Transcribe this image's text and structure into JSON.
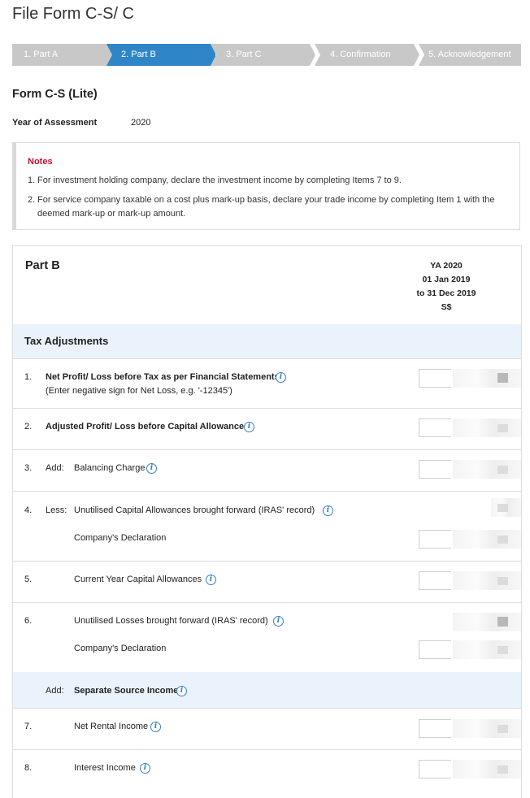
{
  "page_title": "File Form C-S/ C",
  "steps": [
    {
      "label": "1. Part A",
      "state": "inactive"
    },
    {
      "label": "2. Part B",
      "state": "active"
    },
    {
      "label": "3. Part C",
      "state": "inactive"
    },
    {
      "label": "4. Confirmation",
      "state": "inactive"
    },
    {
      "label": "5. Acknowledgement",
      "state": "inactive"
    }
  ],
  "colors": {
    "active_step": "#2e86c9",
    "inactive_step": "#c8c8c8",
    "notes_title": "#c8102e",
    "band": "#eaf3fb",
    "info_icon": "#3a7fc4"
  },
  "form_title": "Form C-S (Lite)",
  "year_of_assessment": {
    "label": "Year of Assessment",
    "value": "2020"
  },
  "notes": {
    "title": "Notes",
    "items": [
      {
        "num": "1.",
        "text": "For investment holding company, declare the investment income by completing Items 7 to 9."
      },
      {
        "num": "2.",
        "text": "For service company taxable on a cost plus mark-up basis, declare your trade income by completing Item 1 with the deemed mark-up or mark-up amount."
      }
    ]
  },
  "part_b": {
    "title": "Part B",
    "column_header": [
      "YA 2020",
      "01 Jan 2019",
      "to 31 Dec 2019",
      "S$"
    ],
    "tax_adjustments": "Tax Adjustments",
    "rows": [
      {
        "num": "1.",
        "prefix": "",
        "label": "Net Profit/ Loss before Tax as per Financial Statements",
        "sub": "(Enter negative sign for Net Loss, e.g. '-12345')"
      },
      {
        "num": "2.",
        "prefix": "",
        "label": "Adjusted Profit/ Loss before Capital Allowances"
      },
      {
        "num": "3.",
        "prefix": "Add:",
        "label": "Balancing Charge"
      },
      {
        "num": "4.",
        "prefix": "Less:",
        "label": "Unutilised Capital Allowances brought forward (IRAS' record)",
        "declaration": "Company's Declaration"
      },
      {
        "num": "5.",
        "prefix": "",
        "label": "Current Year Capital Allowances"
      },
      {
        "num": "6.",
        "prefix": "",
        "label": "Unutilised Losses brought forward (IRAS' record)",
        "declaration": "Company's Declaration"
      },
      {
        "num": "",
        "prefix": "Add:",
        "label": "Separate Source Income"
      },
      {
        "num": "7.",
        "prefix": "",
        "label": "Net Rental Income"
      },
      {
        "num": "8.",
        "prefix": "",
        "label": "Interest Income"
      }
    ]
  }
}
